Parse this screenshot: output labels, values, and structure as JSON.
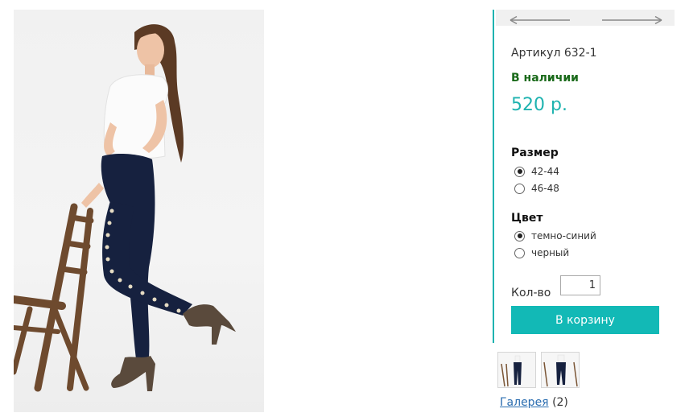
{
  "product": {
    "sku": "Артикул 632-1",
    "availability": "В наличии",
    "price": "520 р."
  },
  "navigation": {
    "prev_icon": "arrow-left-icon",
    "next_icon": "arrow-right-icon"
  },
  "size": {
    "title": "Размер",
    "options": [
      {
        "label": "42-44",
        "checked": true
      },
      {
        "label": "46-48",
        "checked": false
      }
    ]
  },
  "color": {
    "title": "Цвет",
    "options": [
      {
        "label": "темно-синий",
        "checked": true
      },
      {
        "label": "черный",
        "checked": false
      }
    ]
  },
  "quantity": {
    "label": "Кол-во",
    "value": "1"
  },
  "cart_button": "В корзину",
  "gallery": {
    "link": "Галерея",
    "count": "(2)"
  },
  "colors": {
    "accent": "#12b9b6",
    "price": "#1fb3b0",
    "in_stock": "#1a6a1a",
    "link": "#2a6db0",
    "jeans": "#16213f"
  }
}
